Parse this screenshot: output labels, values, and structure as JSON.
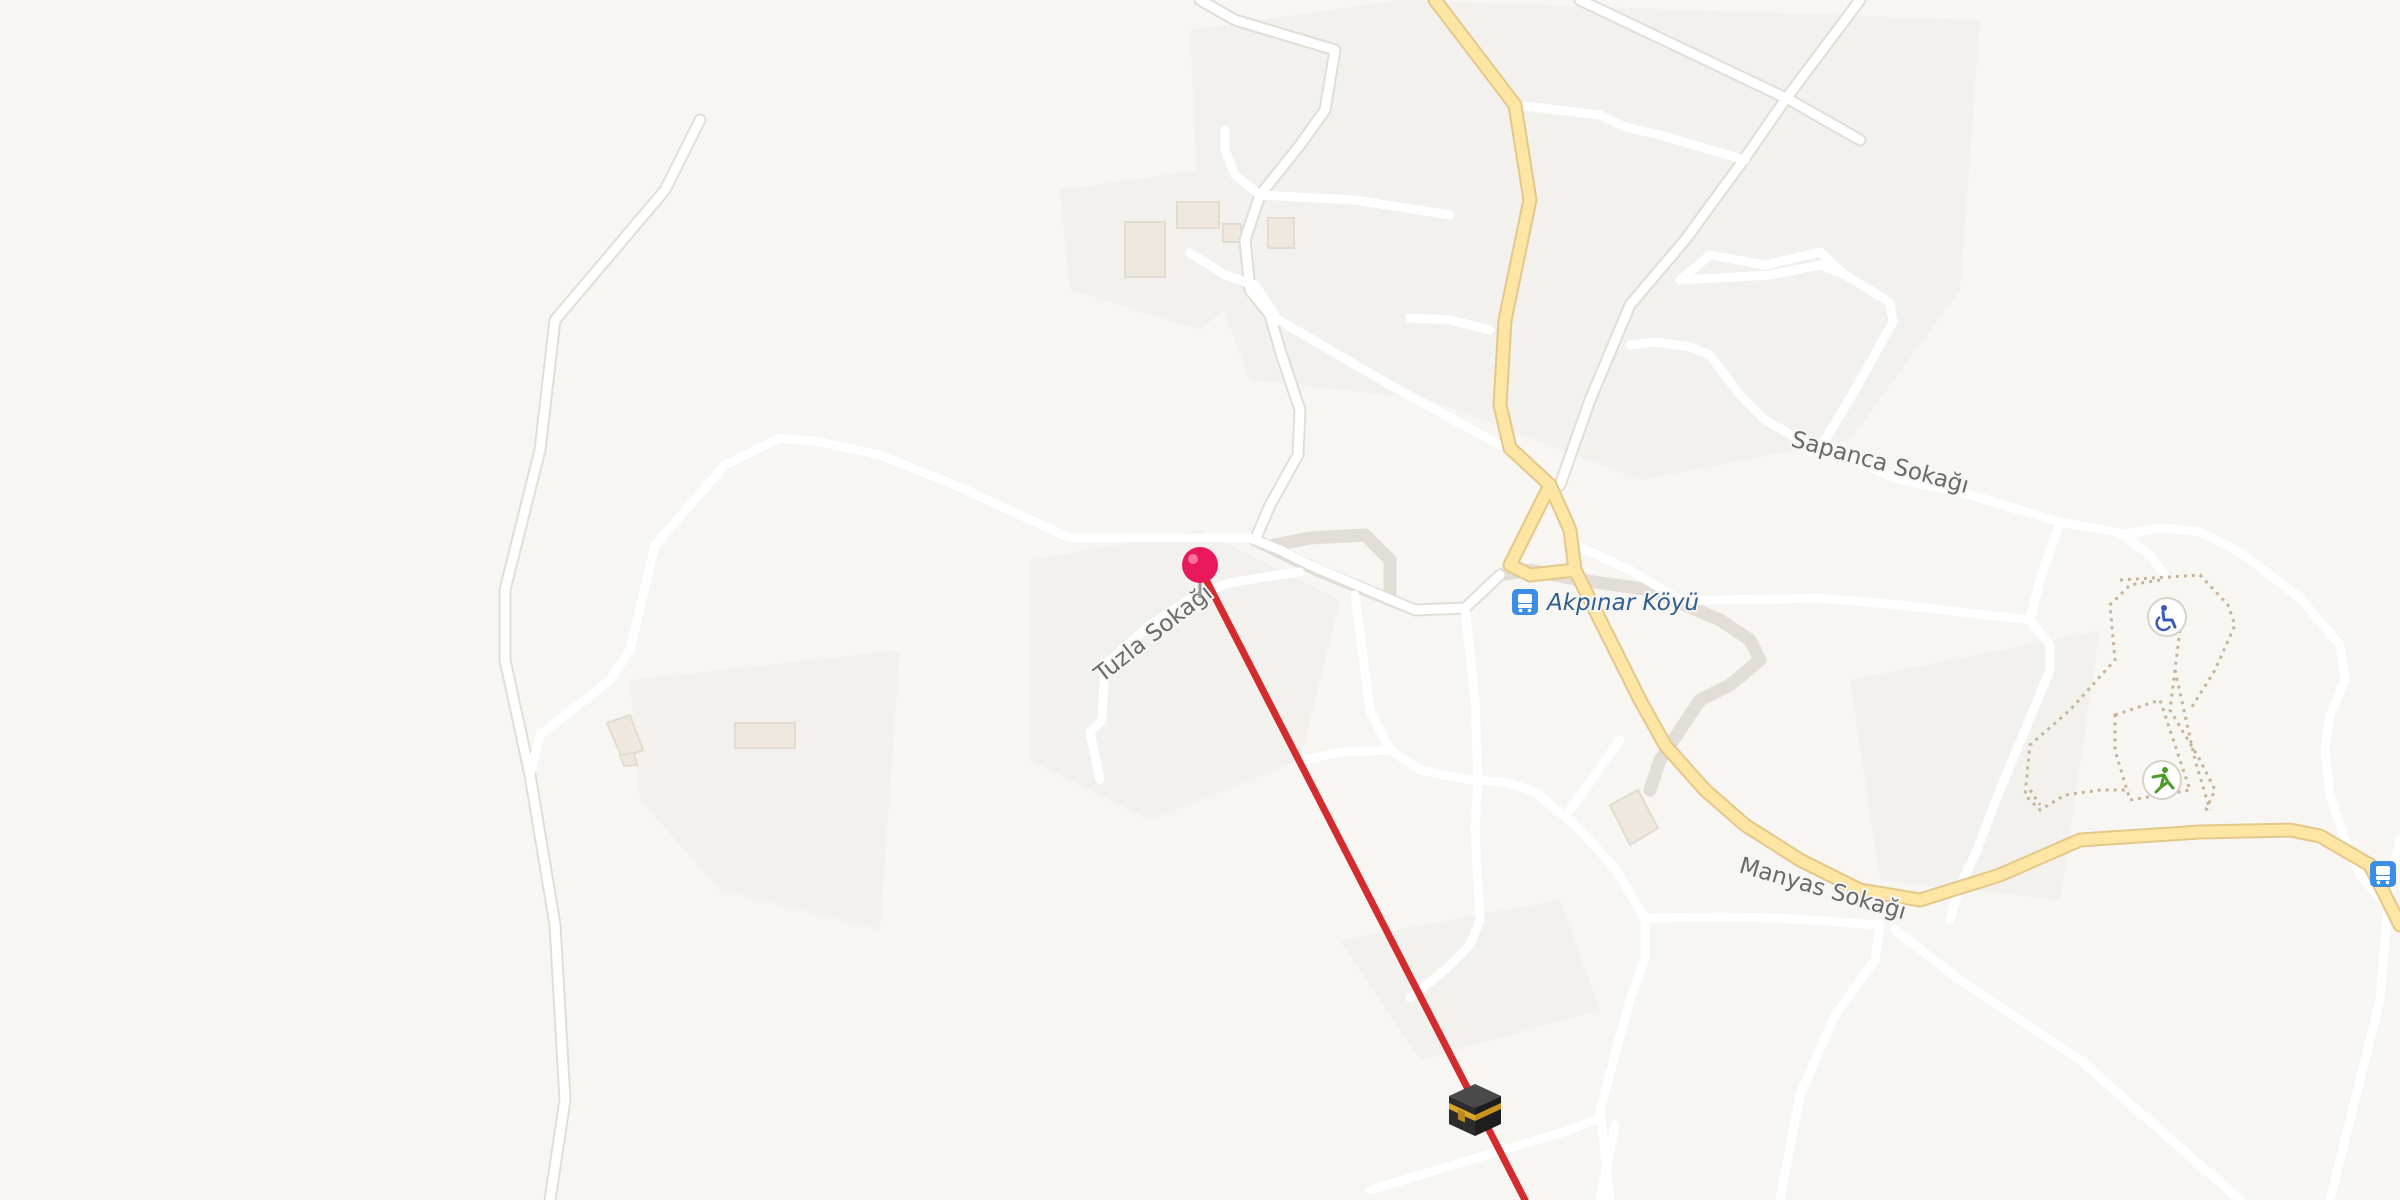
{
  "map": {
    "street_labels": {
      "sapanca": "Sapanca Sokağı",
      "tuzla": "Tuzla Sokağı",
      "manyas": "Manyas Sokağı"
    },
    "poi_labels": {
      "bus_stop": "Akpınar Köyü"
    },
    "icons": {
      "location_pin": "location-pin-icon",
      "kaaba": "kaaba-icon",
      "bus_stop": "bus-stop-icon",
      "bus_stop_edge": "bus-stop-icon",
      "wheelchair": "wheelchair-icon",
      "fitness": "fitness-icon"
    },
    "colors": {
      "background": "#f8f6f3",
      "road": "#ffffff",
      "major_road": "#fde5a4",
      "qibla_line": "#d42b2f",
      "pin": "#e8185a",
      "bus_blue": "#3a8ee6"
    }
  }
}
